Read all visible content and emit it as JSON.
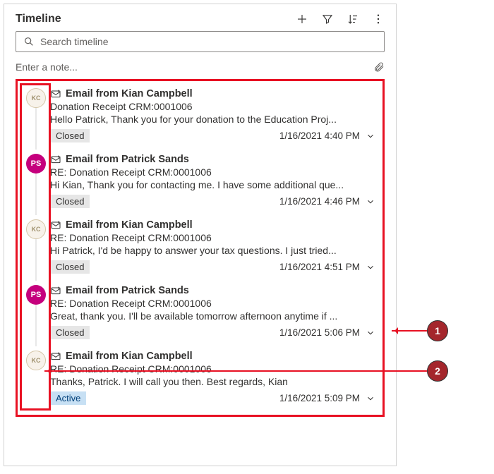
{
  "header": {
    "title": "Timeline"
  },
  "search": {
    "placeholder": "Search timeline"
  },
  "note": {
    "placeholder": "Enter a note..."
  },
  "items": [
    {
      "avatar": "KC",
      "avatarClass": "kc",
      "title": "Email from Kian Campbell",
      "subject": "Donation Receipt CRM:0001006",
      "preview": "Hello Patrick,   Thank you for your donation to the Education Proj...",
      "status": "Closed",
      "statusClass": "closed",
      "time": "1/16/2021 4:40 PM"
    },
    {
      "avatar": "PS",
      "avatarClass": "ps",
      "title": "Email from Patrick Sands",
      "subject": "RE: Donation Receipt CRM:0001006",
      "preview": "Hi Kian, Thank you for contacting me. I have some additional que...",
      "status": "Closed",
      "statusClass": "closed",
      "time": "1/16/2021 4:46 PM"
    },
    {
      "avatar": "KC",
      "avatarClass": "kc",
      "title": "Email from Kian Campbell",
      "subject": "RE: Donation Receipt CRM:0001006",
      "preview": "Hi Patrick,   I'd be happy to answer your tax questions. I just tried...",
      "status": "Closed",
      "statusClass": "closed",
      "time": "1/16/2021 4:51 PM"
    },
    {
      "avatar": "PS",
      "avatarClass": "ps",
      "title": "Email from Patrick Sands",
      "subject": "RE: Donation Receipt CRM:0001006",
      "preview": "Great, thank you. I'll be available tomorrow afternoon anytime if ...",
      "status": "Closed",
      "statusClass": "closed",
      "time": "1/16/2021 5:06 PM"
    },
    {
      "avatar": "KC",
      "avatarClass": "kc",
      "title": "Email from Kian Campbell",
      "subject": "RE: Donation Receipt CRM:0001006",
      "preview": "Thanks, Patrick. I will call you then.   Best regards, Kian",
      "status": "Active",
      "statusClass": "active",
      "time": "1/16/2021 5:09 PM"
    }
  ],
  "callouts": {
    "c1": "1",
    "c2": "2"
  }
}
